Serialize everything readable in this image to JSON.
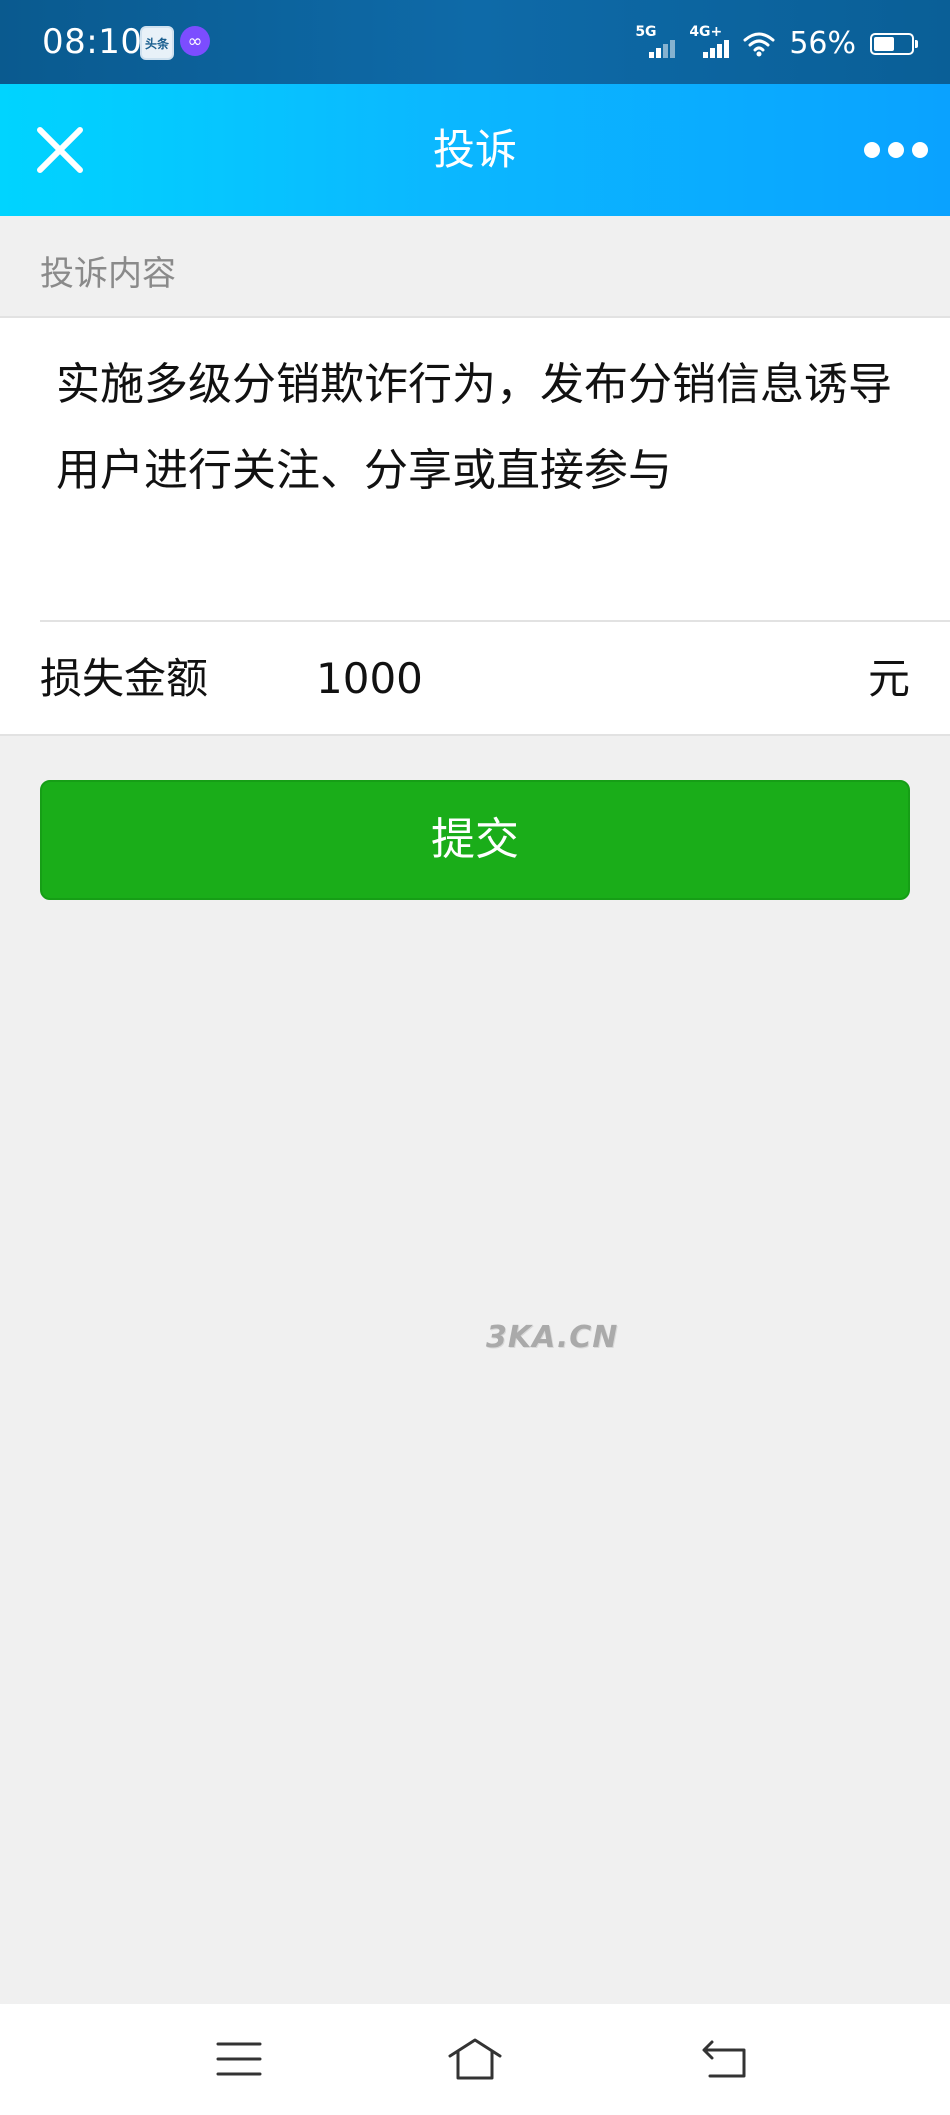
{
  "status_bar": {
    "time": "08:10",
    "app_icons": [
      "toutiao-icon",
      "infinity-icon"
    ],
    "toutiao_label": "头条",
    "signal_1": "5G",
    "signal_2": "4G+",
    "battery_percent": "56%",
    "battery_level": 0.56
  },
  "header": {
    "title": "投诉",
    "close_icon": "close-icon",
    "more_icon": "more-dots-icon"
  },
  "form": {
    "section_label": "投诉内容",
    "complaint_text": "实施多级分销欺诈行为，发布分销信息诱导用户进行关注、分享或直接参与",
    "loss_label": "损失金额",
    "loss_value": "1000",
    "loss_unit": "元"
  },
  "submit": {
    "label": "提交"
  },
  "watermark": "3KA.CN",
  "nav": {
    "items": [
      "menu-icon",
      "home-icon",
      "back-icon"
    ]
  },
  "colors": {
    "status_bar": "#0e6aa8",
    "header_gradient_start": "#00d4ff",
    "header_gradient_end": "#0aa2ff",
    "submit_green": "#1aad19",
    "background": "#f0f0f0"
  }
}
